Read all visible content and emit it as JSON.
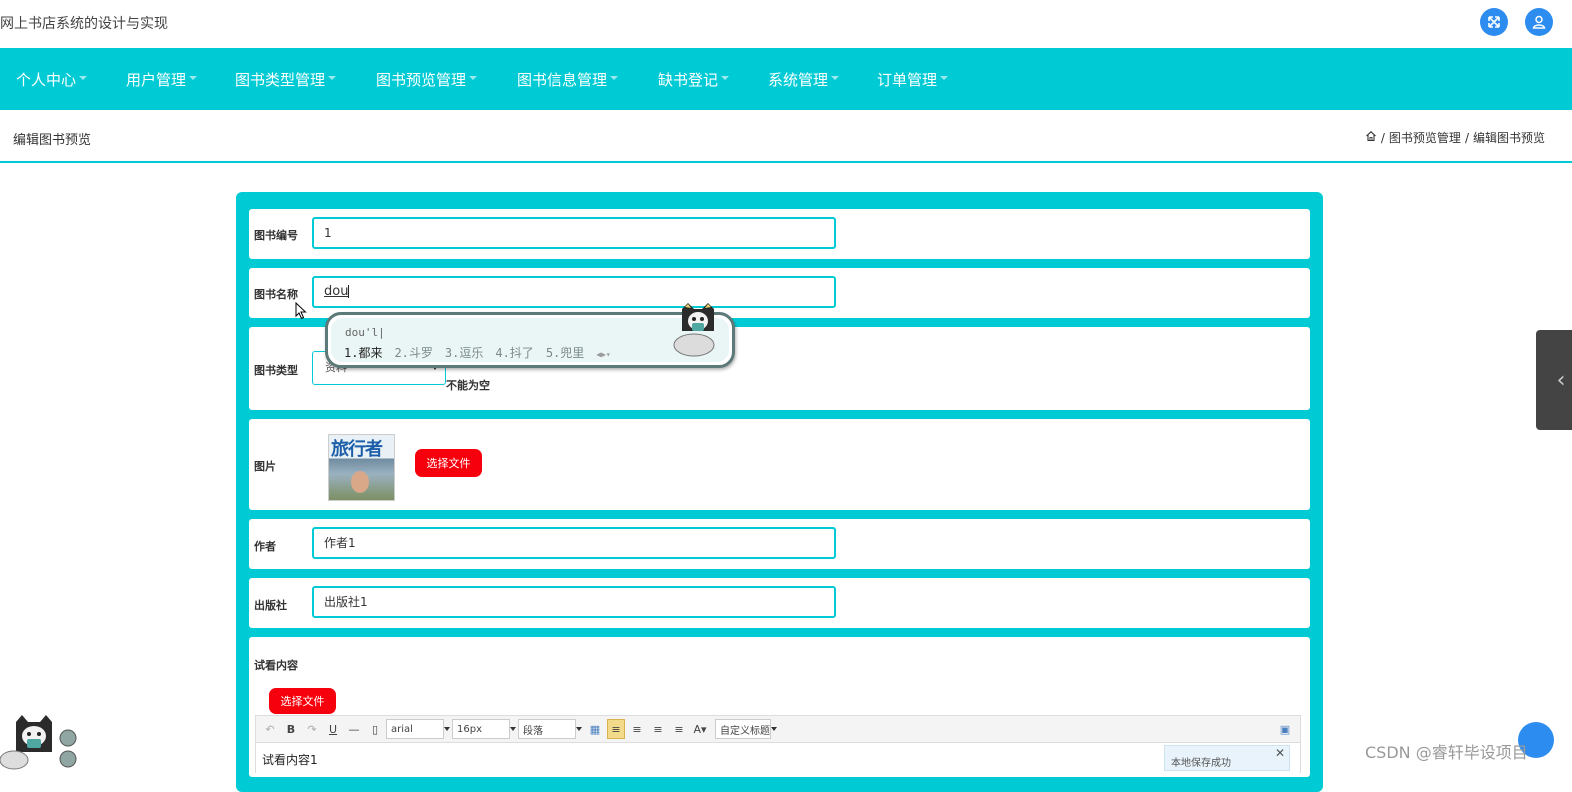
{
  "app": {
    "title": "网上书店系统的设计与实现"
  },
  "topbar": {
    "icons": [
      "fullscreen-icon",
      "user-icon"
    ],
    "accent": "#2d8cf0"
  },
  "nav": {
    "color": "#00cbd5",
    "items": [
      "个人中心",
      "用户管理",
      "图书类型管理",
      "图书预览管理",
      "图书信息管理",
      "缺书登记",
      "系统管理",
      "订单管理"
    ]
  },
  "page": {
    "title": "编辑图书预览",
    "breadcrumb": [
      "图书预览管理",
      "编辑图书预览"
    ]
  },
  "form": {
    "book_no": {
      "label": "图书编号",
      "value": "1"
    },
    "book_name": {
      "label": "图书名称",
      "value": "dou"
    },
    "book_type": {
      "label": "图书类型",
      "value": "资料",
      "note": "不能为空"
    },
    "image": {
      "label": "图片",
      "thumb_text": "旅行者",
      "button": "选择文件"
    },
    "author": {
      "label": "作者",
      "value": "作者1"
    },
    "publisher": {
      "label": "出版社",
      "value": "出版社1"
    },
    "preview": {
      "label": "试看内容",
      "button": "选择文件",
      "content": "试看内容1"
    },
    "button_color": "#f5000c"
  },
  "editor": {
    "toolbar": {
      "font": "arial",
      "size": "16px",
      "paragraph": "段落",
      "custom_title": "自定义标题"
    },
    "save_tip": "本地保存成功"
  },
  "ime": {
    "composition": "dou'l|",
    "candidates": [
      "1.都来",
      "2.斗罗",
      "3.逗乐",
      "4.抖了",
      "5.兜里"
    ]
  },
  "watermark": "CSDN @睿轩毕设项目"
}
